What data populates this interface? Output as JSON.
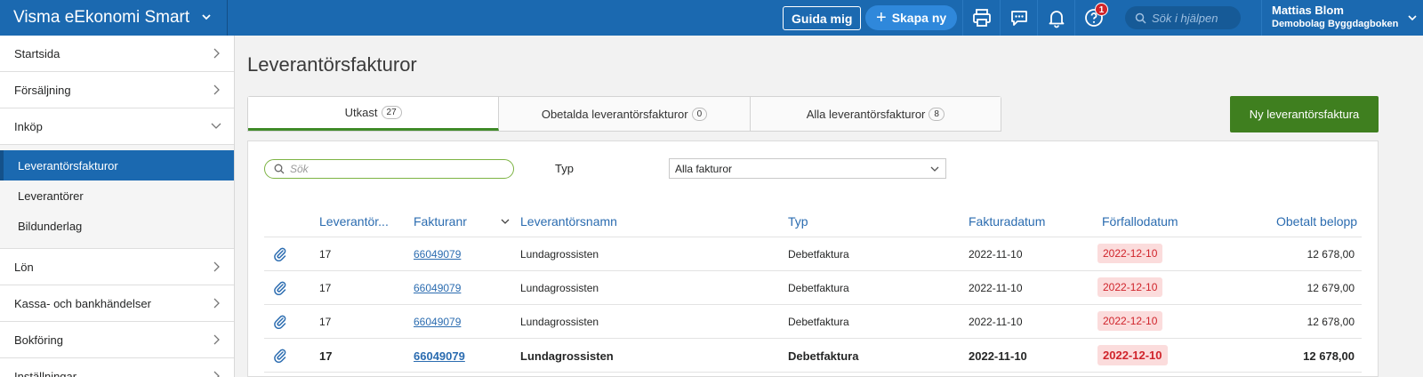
{
  "app": {
    "title": "Visma eEkonomi Smart"
  },
  "topbar": {
    "guide_label": "Guida mig",
    "create_label": "Skapa ny",
    "help_badge": "1",
    "help_search_placeholder": "Sök i hjälpen",
    "user_name": "Mattias Blom",
    "company": "Demobolag Byggdagboken"
  },
  "sidebar": {
    "items": [
      {
        "label": "Startsida"
      },
      {
        "label": "Försäljning"
      },
      {
        "label": "Inköp"
      },
      {
        "label": "Lön"
      },
      {
        "label": "Kassa- och bankhändelser"
      },
      {
        "label": "Bokföring"
      },
      {
        "label": "Inställningar"
      }
    ],
    "sub_items": [
      {
        "label": "Leverantörsfakturor",
        "active": true
      },
      {
        "label": "Leverantörer"
      },
      {
        "label": "Bildunderlag"
      }
    ]
  },
  "main": {
    "title": "Leverantörsfakturor",
    "tabs": [
      {
        "label": "Utkast",
        "count": "27"
      },
      {
        "label": "Obetalda leverantörsfakturor",
        "count": "0"
      },
      {
        "label": "Alla leverantörsfakturor",
        "count": "8"
      }
    ],
    "new_button": "Ny leverantörsfaktura",
    "search_placeholder": "Sök",
    "type_label": "Typ",
    "type_value": "Alla fakturor",
    "columns": [
      "Leverantör...",
      "Fakturanr",
      "Leverantörsnamn",
      "Typ",
      "Fakturadatum",
      "Förfallodatum",
      "Obetalt belopp"
    ],
    "rows": [
      {
        "supplier_no": "17",
        "invoice_no": "66049079",
        "supplier_name": "Lundagrossisten",
        "type": "Debetfaktura",
        "invoice_date": "2022-11-10",
        "due_date": "2022-12-10",
        "amount": "12 678,00"
      },
      {
        "supplier_no": "17",
        "invoice_no": "66049079",
        "supplier_name": "Lundagrossisten",
        "type": "Debetfaktura",
        "invoice_date": "2022-11-10",
        "due_date": "2022-12-10",
        "amount": "12 679,00"
      },
      {
        "supplier_no": "17",
        "invoice_no": "66049079",
        "supplier_name": "Lundagrossisten",
        "type": "Debetfaktura",
        "invoice_date": "2022-11-10",
        "due_date": "2022-12-10",
        "amount": "12 678,00"
      },
      {
        "supplier_no": "17",
        "invoice_no": "66049079",
        "supplier_name": "Lundagrossisten",
        "type": "Debetfaktura",
        "invoice_date": "2022-11-10",
        "due_date": "2022-12-10",
        "amount": "12 678,00"
      }
    ]
  },
  "colors": {
    "brand": "#1b69b0",
    "accent_green": "#3f7f1f",
    "overdue": "#d0242b"
  }
}
